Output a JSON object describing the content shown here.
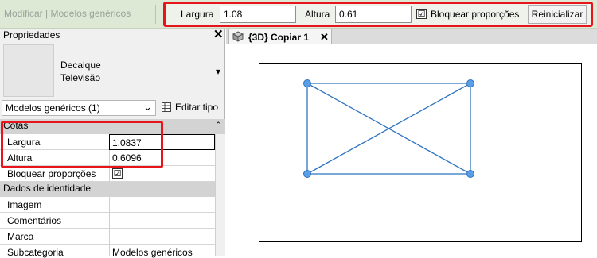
{
  "options_bar": {
    "breadcrumb": "Modificar | Modelos genéricos",
    "width_label": "Largura",
    "width_value": "1.08",
    "height_label": "Altura",
    "height_value": "0.61",
    "lock_label": "Bloquear proporções",
    "lock_checked": "☑",
    "reset_label": "Reinicializar"
  },
  "properties": {
    "title": "Propriedades",
    "close_glyph": "✕",
    "type_name_line1": "Decalque",
    "type_name_line2": "Televisão",
    "type_dropdown_arrow": "▾",
    "selector_value": "Modelos genéricos (1)",
    "selector_arrow": "⌄",
    "edit_type_label": "Editar tipo",
    "sections": [
      {
        "name": "Cotas",
        "collapse_glyph": "⌃",
        "rows": [
          {
            "label": "Largura",
            "value": "1.0837"
          },
          {
            "label": "Altura",
            "value": "0.6096"
          },
          {
            "label": "Bloquear proporções",
            "value": "☑"
          }
        ]
      },
      {
        "name": "Dados de identidade",
        "collapse_glyph": "⌃",
        "rows": [
          {
            "label": "Imagem",
            "value": ""
          },
          {
            "label": "Comentários",
            "value": ""
          },
          {
            "label": "Marca",
            "value": ""
          },
          {
            "label": "Subcategoria",
            "value": "Modelos genéricos"
          }
        ]
      }
    ]
  },
  "view": {
    "tab_label": "{3D} Copiar 1",
    "tab_close": "✕",
    "colors": {
      "highlight": "#e8141c",
      "geometry": "#2f74c0",
      "grip": "#5b9ee8"
    }
  }
}
